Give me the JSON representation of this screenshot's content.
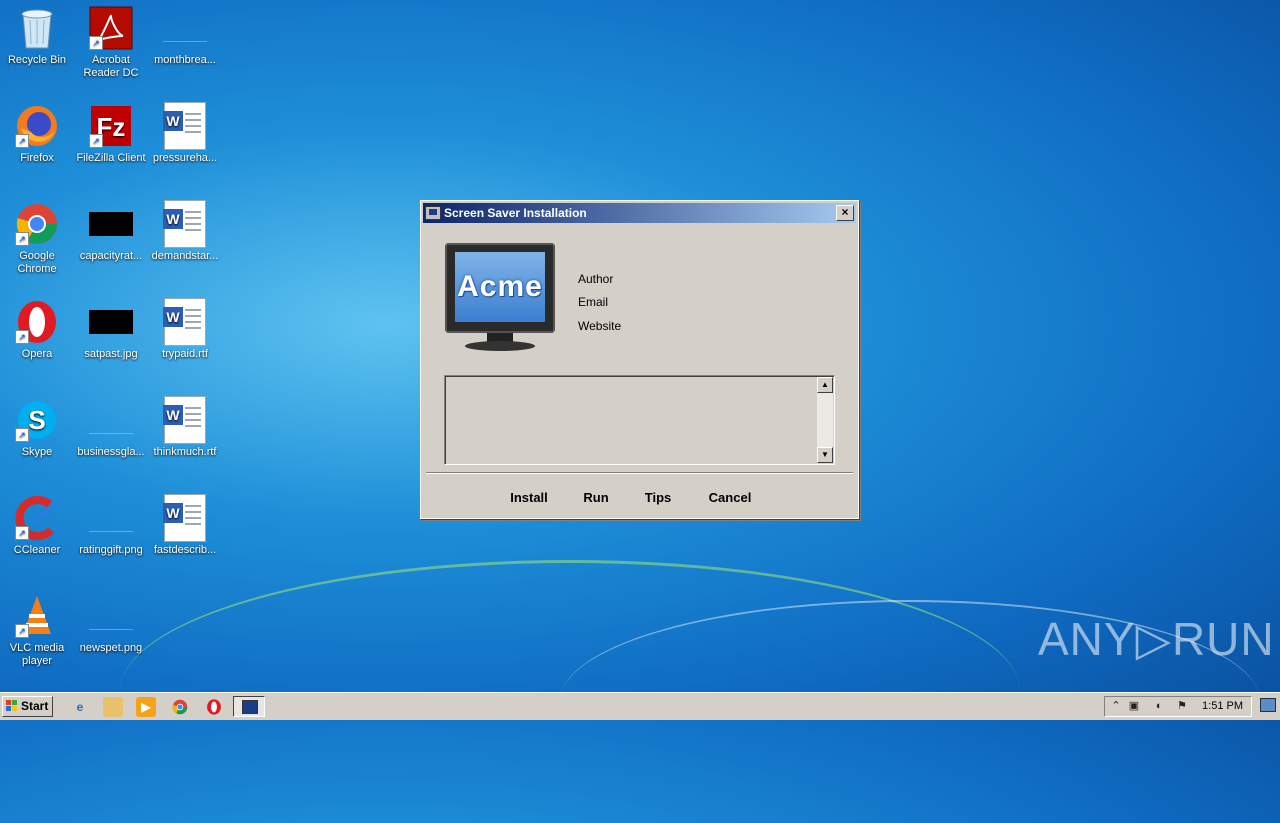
{
  "desktop": {
    "icons": [
      {
        "label": "Recycle Bin",
        "icon": "recycle-bin-icon"
      },
      {
        "label": "Acrobat Reader DC",
        "icon": "acrobat-icon"
      },
      {
        "label": "monthbrea...",
        "icon": "blank-file-icon"
      },
      {
        "label": "Firefox",
        "icon": "firefox-icon"
      },
      {
        "label": "FileZilla Client",
        "icon": "filezilla-icon"
      },
      {
        "label": "pressureha...",
        "icon": "word-document-icon"
      },
      {
        "label": "Google Chrome",
        "icon": "chrome-icon"
      },
      {
        "label": "capacityrat...",
        "icon": "black-image-icon"
      },
      {
        "label": "demandstar...",
        "icon": "word-document-icon"
      },
      {
        "label": "Opera",
        "icon": "opera-icon"
      },
      {
        "label": "satpast.jpg",
        "icon": "black-image-icon"
      },
      {
        "label": "trypaid.rtf",
        "icon": "word-document-icon"
      },
      {
        "label": "Skype",
        "icon": "skype-icon"
      },
      {
        "label": "businessgla...",
        "icon": "blank-file-icon"
      },
      {
        "label": "thinkmuch.rtf",
        "icon": "word-document-icon"
      },
      {
        "label": "CCleaner",
        "icon": "ccleaner-icon"
      },
      {
        "label": "ratinggift.png",
        "icon": "blank-file-icon"
      },
      {
        "label": "fastdescrib...",
        "icon": "word-document-icon"
      },
      {
        "label": "VLC media player",
        "icon": "vlc-icon"
      },
      {
        "label": "newspet.png",
        "icon": "blank-file-icon"
      }
    ]
  },
  "dialog": {
    "title": "Screen Saver Installation",
    "close_label": "×",
    "logo_text": "Acme",
    "author_label": "Author",
    "email_label": "Email",
    "website_label": "Website",
    "description": "",
    "buttons": {
      "install": "Install",
      "run": "Run",
      "tips": "Tips",
      "cancel": "Cancel"
    }
  },
  "taskbar": {
    "start_label": "Start",
    "clock": "1:51 PM"
  },
  "watermark": "ANY▷RUN"
}
